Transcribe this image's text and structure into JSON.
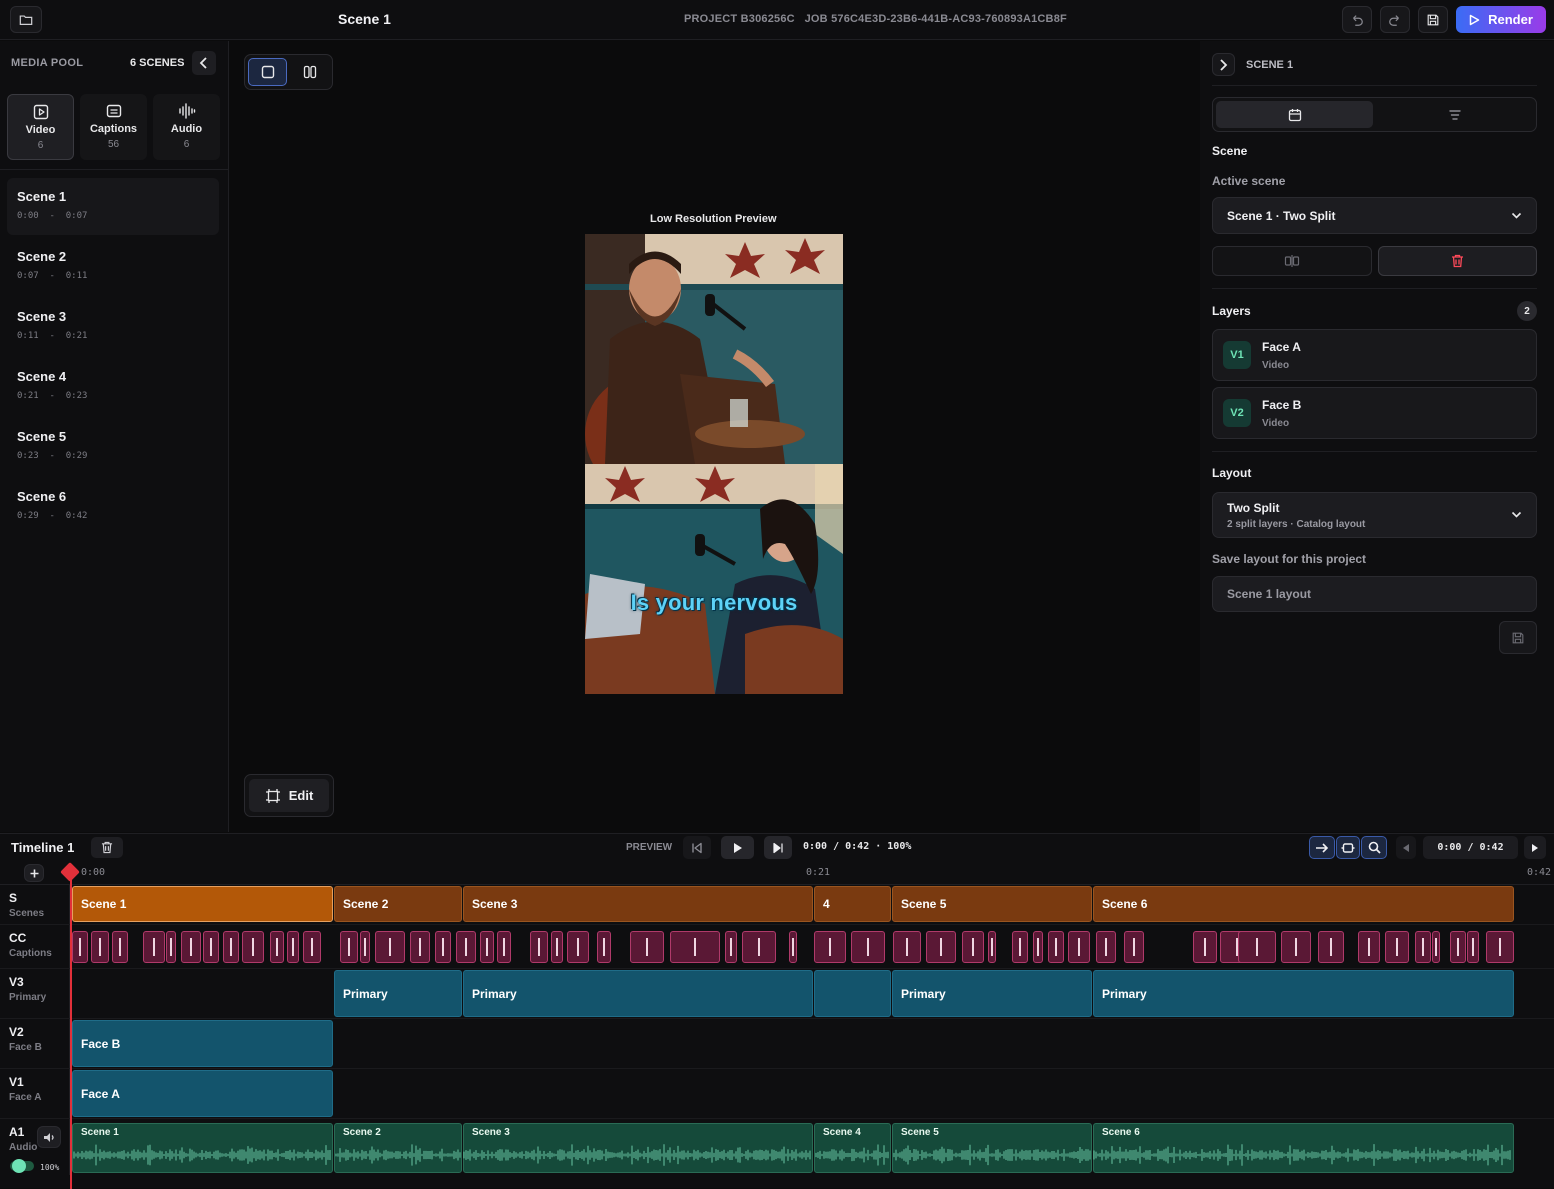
{
  "topbar": {
    "title": "Scene 1",
    "project": "PROJECT B306256C",
    "job": "JOB 576C4E3D-23B6-441B-AC93-760893A1CB8F",
    "render_label": "Render"
  },
  "media_pool": {
    "heading": "MEDIA POOL",
    "count": "6 SCENES",
    "tabs": [
      {
        "label": "Video",
        "count": "6",
        "icon": "video-icon"
      },
      {
        "label": "Captions",
        "count": "56",
        "icon": "captions-icon"
      },
      {
        "label": "Audio",
        "count": "6",
        "icon": "audio-icon"
      }
    ],
    "scenes": [
      {
        "name": "Scene 1",
        "time": "0:00  -  0:07"
      },
      {
        "name": "Scene 2",
        "time": "0:07  -  0:11"
      },
      {
        "name": "Scene 3",
        "time": "0:11  -  0:21"
      },
      {
        "name": "Scene 4",
        "time": "0:21  -  0:23"
      },
      {
        "name": "Scene 5",
        "time": "0:23  -  0:29"
      },
      {
        "name": "Scene 6",
        "time": "0:29  -  0:42"
      }
    ]
  },
  "viewer": {
    "preview_label": "Low Resolution Preview",
    "caption": "Is your nervous",
    "edit_label": "Edit"
  },
  "inspector": {
    "header": "SCENE 1",
    "section_scene": "Scene",
    "active_scene_label": "Active scene",
    "active_scene_value": "Scene 1 · Two Split",
    "layers_label": "Layers",
    "layers_count": "2",
    "layers": [
      {
        "tag": "V1",
        "name": "Face A",
        "type": "Video"
      },
      {
        "tag": "V2",
        "name": "Face B",
        "type": "Video"
      }
    ],
    "layout_label": "Layout",
    "layout_value": "Two Split",
    "layout_sub": "2 split layers · Catalog layout",
    "save_layout_label": "Save layout for this project",
    "save_layout_value": "Scene 1 layout"
  },
  "timeline": {
    "title": "Timeline 1",
    "preview_label": "PREVIEW",
    "timecode": "0:00 / 0:42 · 100%",
    "timecode_right": "0:00 / 0:42",
    "ruler": [
      "0:00",
      "0:21",
      "0:42"
    ],
    "tracks": [
      {
        "name": "S",
        "sub": "Scenes"
      },
      {
        "name": "CC",
        "sub": "Captions"
      },
      {
        "name": "V3",
        "sub": "Primary"
      },
      {
        "name": "V2",
        "sub": "Face B"
      },
      {
        "name": "V1",
        "sub": "Face A"
      },
      {
        "name": "A1",
        "sub": "Audio"
      }
    ],
    "scene_clips": [
      "Scene 1",
      "Scene 2",
      "Scene 3",
      "4",
      "Scene 5",
      "Scene 6"
    ],
    "v3_clips": [
      "Primary",
      "Primary",
      "",
      "Primary",
      "Primary"
    ],
    "v2_clip": "Face B",
    "v1_clip": "Face A",
    "audio_clips": [
      "Scene 1",
      "Scene 2",
      "Scene 3",
      "Scene 4",
      "Scene 5",
      "Scene 6"
    ],
    "audio_volume": "100%"
  },
  "colors": {
    "accent": "#3a6cf5",
    "scene_clip": "#7a3a10",
    "scene_clip_selected": "#b35808",
    "video_clip": "#13546c",
    "caption_clip": "#5a1835",
    "audio_clip": "#154a3a",
    "playhead": "#e2303a"
  }
}
